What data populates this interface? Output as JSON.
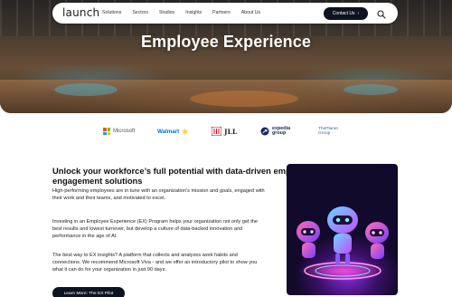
{
  "nav": {
    "logo": "launch",
    "links": [
      "Solutions",
      "Sectors",
      "Studios",
      "Insights",
      "Partners",
      "About Us"
    ],
    "contact_label": "Contact Us",
    "contact_arrow": "›",
    "search_icon": "search-icon"
  },
  "hero": {
    "title": "Employee Experience"
  },
  "partners": {
    "microsoft": "Microsoft",
    "walmart": "Walmart",
    "jll": "JLL",
    "expedia_line1": "expedia",
    "expedia_line2": "group",
    "planet_line1": "ThePlanet",
    "planet_line2": "Group"
  },
  "content": {
    "heading": "Unlock your workforce’s full potential with data-driven employee engagement solutions",
    "para1": "High-performing employees are in tune with an organization’s mission and goals, engaged with their work and their teams, and motivated to excel.",
    "para2": "Investing in an Employee Experience (EX) Program helps your organization not only get the best results and lowest turnover, but develop a culture of data-backed innovation and performance in the age of AI.",
    "para3": "The best way to EX insights? A platform that collects and analyzes work habits and connections. We recommend Microsoft Viva - and we offer an introductory pilot to show you what it can do for your organization in just 90 days.",
    "cta_label": "Learn More: The EX Pilot"
  },
  "colors": {
    "dark_button": "#0e1320",
    "accent_purple": "#8a2be2",
    "walmart_blue": "#0071ce",
    "walmart_yellow": "#ffc220",
    "jll_red": "#e30613",
    "expedia_navy": "#1b2a5b"
  }
}
